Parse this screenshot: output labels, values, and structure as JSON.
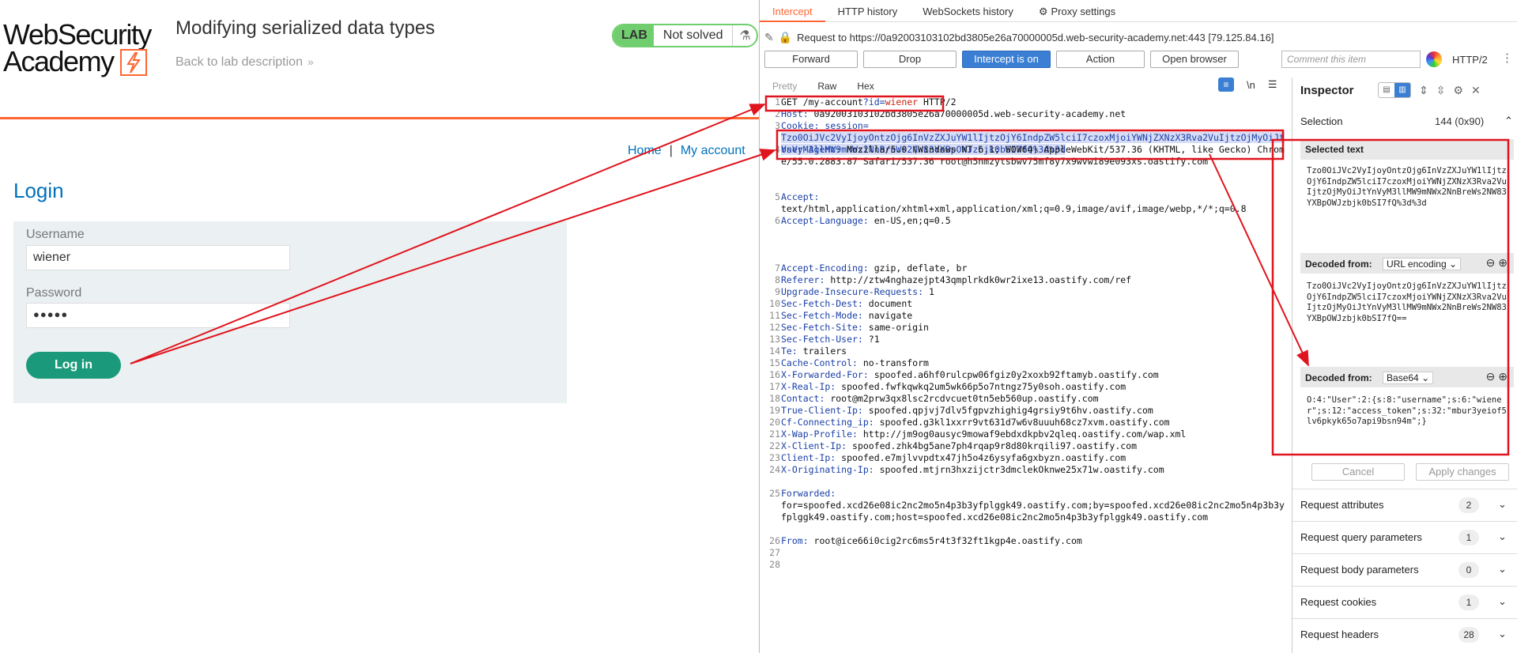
{
  "left": {
    "logo": {
      "line1": "WebSecurity",
      "line2": "Academy"
    },
    "lab_title": "Modifying serialized data types",
    "back_link": "Back to lab description",
    "badge": {
      "lab": "LAB",
      "status": "Not solved"
    },
    "nav": {
      "home": "Home",
      "sep": "|",
      "account": "My account"
    },
    "login_heading": "Login",
    "username_label": "Username",
    "username_value": "wiener",
    "password_label": "Password",
    "password_value": "●●●●●",
    "login_button": "Log in"
  },
  "burp": {
    "tabs": [
      "Intercept",
      "HTTP history",
      "WebSockets history",
      "Proxy settings"
    ],
    "request_to": "Request to https://0a92003103102bd3805e26a70000005d.web-security-academy.net:443  [79.125.84.16]",
    "buttons": {
      "forward": "Forward",
      "drop": "Drop",
      "intercept": "Intercept is on",
      "action": "Action",
      "open_browser": "Open browser"
    },
    "comment_placeholder": "Comment this item",
    "protocol": "HTTP/2",
    "editor_tabs": [
      "Pretty",
      "Raw",
      "Hex"
    ],
    "editor_icons": {
      "newline": "\\n",
      "menu": "☰"
    },
    "lines": [
      {
        "n": "1",
        "parts": [
          [
            "GET /my-account",
            ""
          ],
          [
            "?id=",
            "hname"
          ],
          [
            "wiener",
            "red"
          ],
          [
            " HTTP/2",
            ""
          ]
        ]
      },
      {
        "n": "2",
        "parts": [
          [
            "Host: ",
            "hname"
          ],
          [
            "0a92003103102bd3805e26a70000005d.web-security-academy.net",
            ""
          ]
        ]
      },
      {
        "n": "3",
        "parts": [
          [
            "Cookie: ",
            "hname"
          ],
          [
            "session=",
            "hname"
          ],
          [
            "\nTzo0OiJVc2VyIjoyOntzOjg6InVzZXJuYW1lIjtzOjY6IndpZW5lciI7czoxMjoiYWNjZXNzX3Rva2VuIjtzOjMyOiJtYnVyM3llMW9mNWx2NnBreWs2NW83YXBpOWJzbjk0bSI7fQ%3d%3d",
            "hl"
          ]
        ]
      },
      {
        "n": "4",
        "parts": [
          [
            "User-Agent: ",
            "hname"
          ],
          [
            "Mozilla/5.0 (Windows NT 6.1; WOW64) AppleWebKit/537.36 (KHTML, like Gecko) Chrome/55.0.2883.87 Safari/537.36 root@h5nmzytsbwv75mf8y7x9wvwi89e093xs.oastify.com",
            ""
          ]
        ]
      },
      {
        "n": "5",
        "parts": [
          [
            "Accept: ",
            "hname"
          ],
          [
            "\ntext/html,application/xhtml+xml,application/xml;q=0.9,image/avif,image/webp,*/*;q=0.8",
            ""
          ]
        ]
      },
      {
        "n": "6",
        "parts": [
          [
            "Accept-Language: ",
            "hname"
          ],
          [
            "en-US,en;q=0.5",
            ""
          ]
        ]
      },
      {
        "n": "7",
        "parts": [
          [
            "Accept-Encoding: ",
            "hname"
          ],
          [
            "gzip, deflate, br",
            ""
          ]
        ]
      },
      {
        "n": "8",
        "parts": [
          [
            "Referer: ",
            "hname"
          ],
          [
            "http://ztw4nghazejpt43qmplrkdk0wr2ixe13.oastify.com/ref",
            ""
          ]
        ]
      },
      {
        "n": "9",
        "parts": [
          [
            "Upgrade-Insecure-Requests: ",
            "hname"
          ],
          [
            "1",
            ""
          ]
        ]
      },
      {
        "n": "10",
        "parts": [
          [
            "Sec-Fetch-Dest: ",
            "hname"
          ],
          [
            "document",
            ""
          ]
        ]
      },
      {
        "n": "11",
        "parts": [
          [
            "Sec-Fetch-Mode: ",
            "hname"
          ],
          [
            "navigate",
            ""
          ]
        ]
      },
      {
        "n": "12",
        "parts": [
          [
            "Sec-Fetch-Site: ",
            "hname"
          ],
          [
            "same-origin",
            ""
          ]
        ]
      },
      {
        "n": "13",
        "parts": [
          [
            "Sec-Fetch-User: ",
            "hname"
          ],
          [
            "?1",
            ""
          ]
        ]
      },
      {
        "n": "14",
        "parts": [
          [
            "Te: ",
            "hname"
          ],
          [
            "trailers",
            ""
          ]
        ]
      },
      {
        "n": "15",
        "parts": [
          [
            "Cache-Control: ",
            "hname"
          ],
          [
            "no-transform",
            ""
          ]
        ]
      },
      {
        "n": "16",
        "parts": [
          [
            "X-Forwarded-For: ",
            "hname"
          ],
          [
            "spoofed.a6hf0rulcpw06fgiz0y2xoxb92ftamyb.oastify.com",
            ""
          ]
        ]
      },
      {
        "n": "17",
        "parts": [
          [
            "X-Real-Ip: ",
            "hname"
          ],
          [
            "spoofed.fwfkqwkq2um5wk66p5o7ntngz75y0soh.oastify.com",
            ""
          ]
        ]
      },
      {
        "n": "18",
        "parts": [
          [
            "Contact: ",
            "hname"
          ],
          [
            "root@m2prw3qx8lsc2rcdvcuet0tn5eb560up.oastify.com",
            ""
          ]
        ]
      },
      {
        "n": "19",
        "parts": [
          [
            "True-Client-Ip: ",
            "hname"
          ],
          [
            "spoofed.qpjvj7dlv5fgpvzhighig4grsiy9t6hv.oastify.com",
            ""
          ]
        ]
      },
      {
        "n": "20",
        "parts": [
          [
            "Cf-Connecting_ip: ",
            "hname"
          ],
          [
            "spoofed.g3kl1xxrr9vt631d7w6v8uuuh68cz7xvm.oastify.com",
            ""
          ]
        ]
      },
      {
        "n": "21",
        "parts": [
          [
            "X-Wap-Profile: ",
            "hname"
          ],
          [
            "http://jm9og0ausyc9mowaf9ebdxdkpbv2qleq.oastify.com/wap.xml",
            ""
          ]
        ]
      },
      {
        "n": "22",
        "parts": [
          [
            "X-Client-Ip: ",
            "hname"
          ],
          [
            "spoofed.zhk4bg5ane7ph4rqap9r8d80krqili97.oastify.com",
            ""
          ]
        ]
      },
      {
        "n": "23",
        "parts": [
          [
            "Client-Ip: ",
            "hname"
          ],
          [
            "spoofed.e7mjlvvpdtx47jh5o4z6ysyfa6gxbyzn.oastify.com",
            ""
          ]
        ]
      },
      {
        "n": "24",
        "parts": [
          [
            "X-Originating-Ip: ",
            "hname"
          ],
          [
            "spoofed.mtjrn3hxzijctr3dmclekOknwe25x71w.oastify.com",
            ""
          ]
        ]
      },
      {
        "n": "25",
        "parts": [
          [
            "Forwarded: ",
            "hname"
          ],
          [
            "\nfor=spoofed.xcd26e08ic2nc2mo5n4p3b3yfplggk49.oastify.com;by=spoofed.xcd26e08ic2nc2mo5n4p3b3yfplggk49.oastify.com;host=spoofed.xcd26e08ic2nc2mo5n4p3b3yfplggk49.oastify.com",
            ""
          ]
        ]
      },
      {
        "n": "26",
        "parts": [
          [
            "From: ",
            "hname"
          ],
          [
            "root@ice66i0cig2rc6ms5r4t3f32ft1kgp4e.oastify.com",
            ""
          ]
        ]
      },
      {
        "n": "27",
        "parts": []
      },
      {
        "n": "28",
        "parts": []
      }
    ],
    "inspector": {
      "title": "Inspector",
      "selection_label": "Selection",
      "selection_value": "144 (0x90)",
      "selected_text_header": "Selected text",
      "selected_text": "Tzo0OiJVc2VyIjoyOntzOjg6InVzZXJuYW1lIjtzOjY6IndpZW5lciI7czoxMjoiYWNjZXNzX3Rva2VuIjtzOjMyOiJtYnVyM3llMW9mNWx2NnBreWs2NW83YXBpOWJzbjk0bSI7fQ%3d%3d",
      "decoded1_label": "Decoded from:",
      "decoded1_type": "URL encoding",
      "decoded1_text": "Tzo0OiJVc2VyIjoyOntzOjg6InVzZXJuYW1lIjtzOjY6IndpZW5lciI7czoxMjoiYWNjZXNzX3Rva2VuIjtzOjMyOiJtYnVyM3llMW9mNWx2NnBreWs2NW83YXBpOWJzbjk0bSI7fQ==",
      "decoded2_label": "Decoded from:",
      "decoded2_type": "Base64",
      "decoded2_text": "O:4:\"User\":2:{s:8:\"username\";s:6:\"wiener\";s:12:\"access_token\";s:32:\"mbur3yeiof5lv6pkyk65o7api9bsn94m\";}",
      "cancel": "Cancel",
      "apply": "Apply changes",
      "sections": [
        {
          "label": "Request attributes",
          "count": "2"
        },
        {
          "label": "Request query parameters",
          "count": "1"
        },
        {
          "label": "Request body parameters",
          "count": "0"
        },
        {
          "label": "Request cookies",
          "count": "1"
        },
        {
          "label": "Request headers",
          "count": "28"
        }
      ]
    }
  },
  "colors": {
    "burp_orange": "#ff6633",
    "burp_blue": "#3b7fd4",
    "annotation_red": "#e0141e",
    "academy_blue": "#0071bc",
    "login_green": "#1a9a7a"
  }
}
